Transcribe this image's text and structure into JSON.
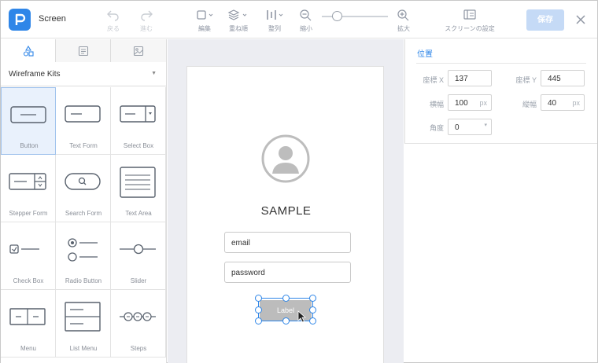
{
  "header": {
    "title": "Screen",
    "undo_label": "戻る",
    "redo_label": "進む",
    "edit_label": "編集",
    "layer_label": "重ね順",
    "align_label": "整列",
    "zoom_out_label": "縮小",
    "zoom_in_label": "拡大",
    "screen_settings_label": "スクリーンの設定",
    "save_label": "保存"
  },
  "left_panel": {
    "kit_select": "Wireframe Kits",
    "components": [
      {
        "label": "Button"
      },
      {
        "label": "Text Form"
      },
      {
        "label": "Select Box"
      },
      {
        "label": "Stepper Form"
      },
      {
        "label": "Search Form"
      },
      {
        "label": "Text Area"
      },
      {
        "label": "Check Box"
      },
      {
        "label": "Radio Button"
      },
      {
        "label": "Slider"
      },
      {
        "label": "Menu"
      },
      {
        "label": "List Menu"
      },
      {
        "label": "Steps"
      }
    ]
  },
  "canvas": {
    "heading": "SAMPLE",
    "email_field": "email",
    "password_field": "password",
    "button_label": "Label"
  },
  "properties": {
    "section_title": "位置",
    "x_label": "座標 X",
    "x_value": "137",
    "y_label": "座標 Y",
    "y_value": "445",
    "width_label": "横幅",
    "width_value": "100",
    "height_label": "縦幅",
    "height_value": "40",
    "unit": "px",
    "angle_label": "角度",
    "angle_value": "0"
  },
  "colors": {
    "accent": "#2f86e8",
    "canvas_bg": "#ecedf2",
    "selected_cell": "#e9f1fc",
    "save_button": "#c5daf6"
  }
}
